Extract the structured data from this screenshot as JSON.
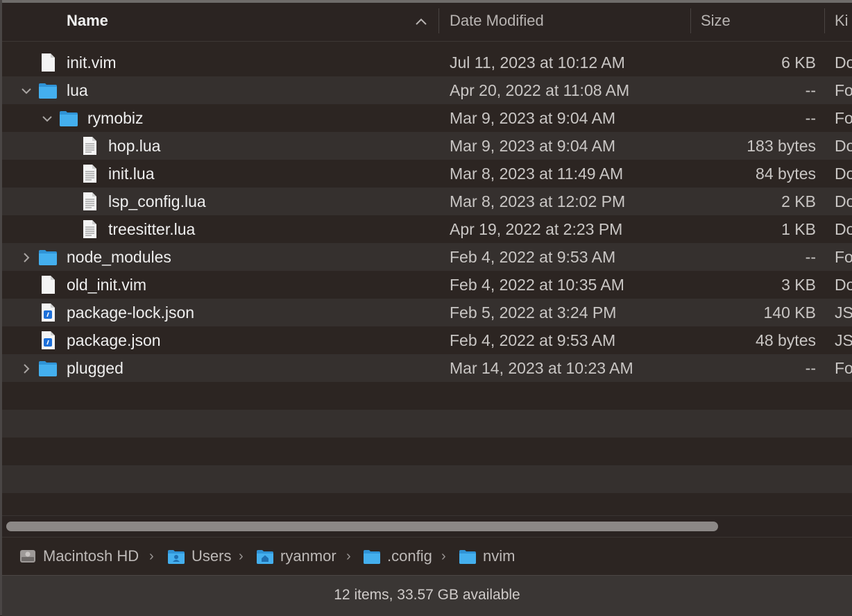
{
  "columns": {
    "name": "Name",
    "date": "Date Modified",
    "size": "Size",
    "kind": "Ki"
  },
  "rows": [
    {
      "name": "init.vim",
      "date": "Jul 11, 2023 at 10:12 AM",
      "size": "6 KB",
      "kind": "Do"
    },
    {
      "name": "lua",
      "date": "Apr 20, 2022 at 11:08 AM",
      "size": "--",
      "kind": "Fo"
    },
    {
      "name": "rymobiz",
      "date": "Mar 9, 2023 at 9:04 AM",
      "size": "--",
      "kind": "Fo"
    },
    {
      "name": "hop.lua",
      "date": "Mar 9, 2023 at 9:04 AM",
      "size": "183 bytes",
      "kind": "Do"
    },
    {
      "name": "init.lua",
      "date": "Mar 8, 2023 at 11:49 AM",
      "size": "84 bytes",
      "kind": "Do"
    },
    {
      "name": "lsp_config.lua",
      "date": "Mar 8, 2023 at 12:02 PM",
      "size": "2 KB",
      "kind": "Do"
    },
    {
      "name": "treesitter.lua",
      "date": "Apr 19, 2022 at 2:23 PM",
      "size": "1 KB",
      "kind": "Do"
    },
    {
      "name": "node_modules",
      "date": "Feb 4, 2022 at 9:53 AM",
      "size": "--",
      "kind": "Fo"
    },
    {
      "name": "old_init.vim",
      "date": "Feb 4, 2022 at 10:35 AM",
      "size": "3 KB",
      "kind": "Do"
    },
    {
      "name": "package-lock.json",
      "date": "Feb 5, 2022 at 3:24 PM",
      "size": "140 KB",
      "kind": "JS"
    },
    {
      "name": "package.json",
      "date": "Feb 4, 2022 at 9:53 AM",
      "size": "48 bytes",
      "kind": "JS"
    },
    {
      "name": "plugged",
      "date": "Mar 14, 2023 at 10:23 AM",
      "size": "--",
      "kind": "Fo"
    }
  ],
  "path": [
    "Macintosh HD",
    "Users",
    "ryanmor",
    ".config",
    "nvim"
  ],
  "status": "12 items, 33.57 GB available",
  "colors": {
    "folder": "#3aa7ea",
    "background": "#2c2522",
    "alt_row": "#35302e"
  }
}
